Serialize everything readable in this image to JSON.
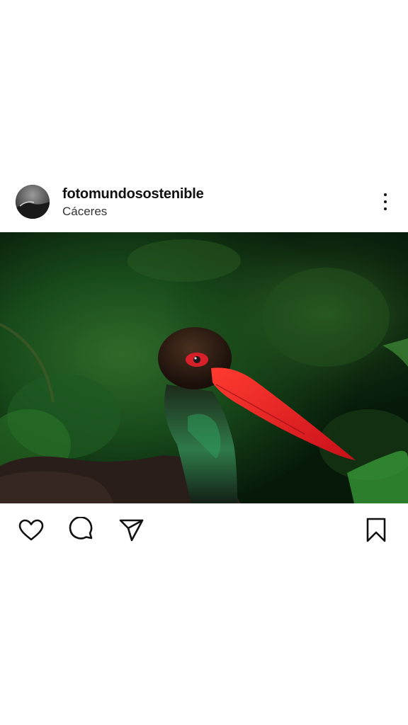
{
  "post": {
    "username": "fotomundosostenible",
    "location": "Cáceres"
  },
  "icons": {
    "avatar": "avatar-image",
    "more": "more-options-icon",
    "like": "heart-icon",
    "comment": "comment-bubble-icon",
    "share": "paper-plane-icon",
    "save": "bookmark-icon"
  },
  "colors": {
    "background": "#ffffff",
    "text": "#111111",
    "secondary_text": "#333333",
    "icon": "#111111"
  }
}
